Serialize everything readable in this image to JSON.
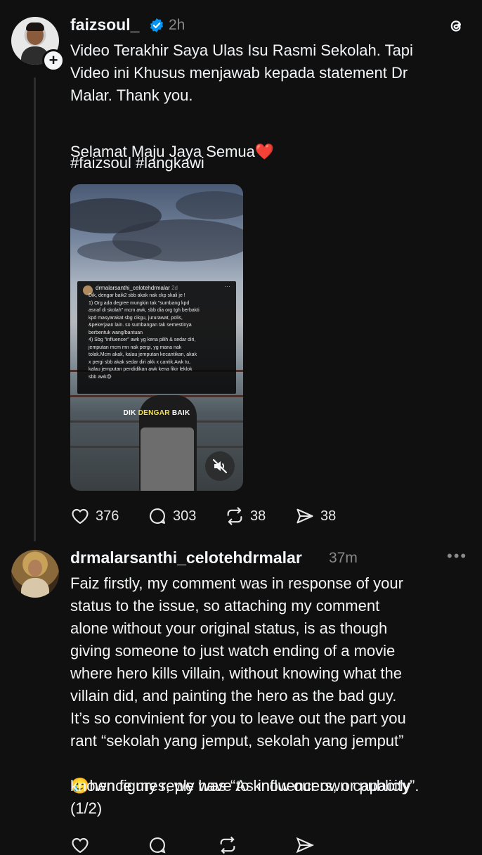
{
  "post": {
    "username": "faizsoul_",
    "time": "2h",
    "text_main": "Video Terakhir Saya Ulas Isu Rasmi Sekolah. Tapi\nVideo ini Khusus menjawab kepada statement Dr\nMalar. Thank you.",
    "text_line2": "Selamat Maju Jaya Semua",
    "heart_emoji": "❤️",
    "hashtags": "#faizsoul #langkawi",
    "media": {
      "overlay_user": "drmalarsanthi_celotehdrmalar",
      "overlay_time": "2d",
      "overlay_text": "Dik, dengar baik2 sbb akak nak ckp skali je !\n1) Org ada degree mungkin tak \"sumbang kpd\nasnaf di skolah\" mcm awk, sbb dia org tgh berbakti\nkpd masyarakat sbg cikgu, jururawat, polis,\n&pekerjaan lain. so sumbangan tak semestinya\nberbentuk wang/bantuan\n4) Sbg \"influencer\" awk yg kena pilih & sedar diri,\njemputan mcm mn nak pergi, yg mana nak\ntolak.Mcm akak, kalau jemputan kecantikan, akak\nx pergi sbb akak sedar diri akk x cantik.Awk tu,\nkalau jemputan pendidikan awk kena fikir leklok\nsbb awk😓",
      "caption_a": "DIK ",
      "caption_b": "DENGAR",
      "caption_c": " BAIK"
    },
    "stats": {
      "likes": "376",
      "replies": "303",
      "reposts": "38",
      "shares": "38"
    }
  },
  "reply": {
    "username": "drmalarsanthi_celotehdrmalar",
    "time": "37m",
    "text_a": "Faiz firstly, my comment was in response of your\nstatus to the issue, so attaching my comment\nalone without your original status, is as though\ngiving someone to just watch ending of a movie\nwhere hero kills villain, without knowing what the\nvillain did, and painting the hero as the bad guy.\nIt’s so convinient for you to leave out the part you\nrant “sekolah yang jemput, sekolah yang jemput”",
    "emoji": "🥲",
    "text_b": "hence my reply was “As influencers, or publicly",
    "text_c": "known figures, we have to know our own capacity”.\n(1/2)"
  },
  "icons": [
    "verified-icon",
    "threads-logo-icon",
    "follow-plus-icon",
    "heart-icon",
    "comment-icon",
    "repost-icon",
    "share-icon",
    "more-icon",
    "mute-icon"
  ],
  "colors": {
    "background": "#101010",
    "text": "#f3f5f7",
    "muted": "#8a8a8a",
    "verified": "#0095f6"
  }
}
